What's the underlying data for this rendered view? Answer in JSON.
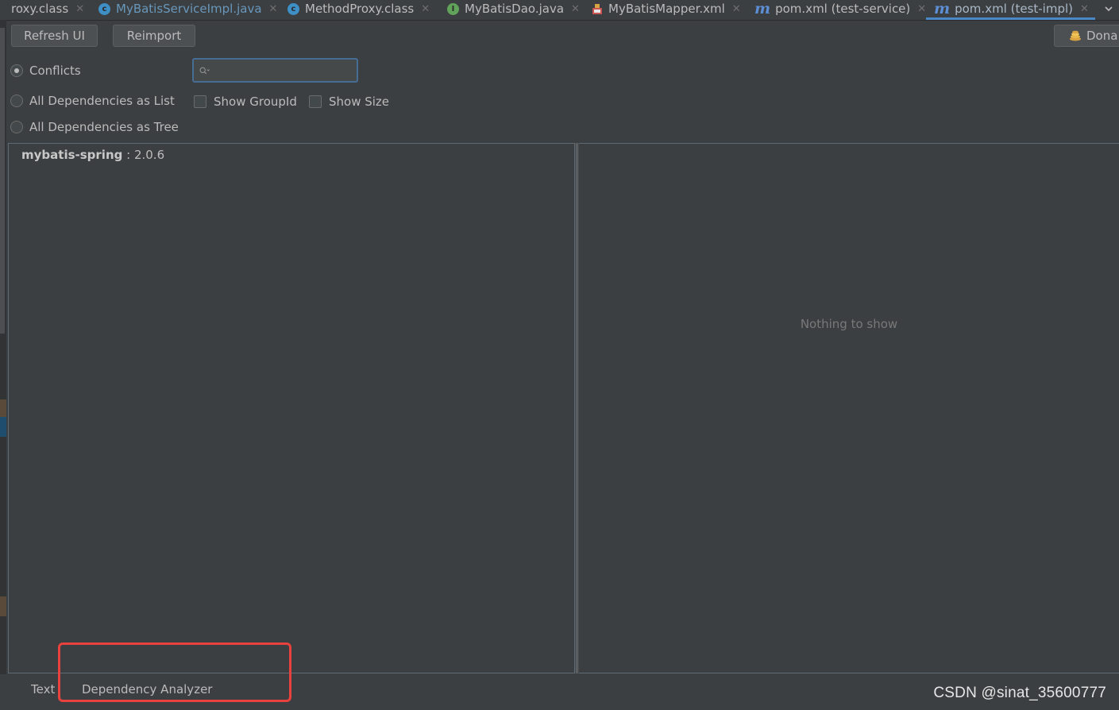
{
  "tabs": [
    {
      "label": "roxy.class",
      "icon": "none",
      "active": false
    },
    {
      "label": "MyBatisServiceImpl.java",
      "icon": "class-icon",
      "active": false
    },
    {
      "label": "MethodProxy.class",
      "icon": "class-icon",
      "active": false
    },
    {
      "label": "MyBatisDao.java",
      "icon": "interface-icon",
      "active": false
    },
    {
      "label": "MyBatisMapper.xml",
      "icon": "xml-icon",
      "active": false
    },
    {
      "label": "pom.xml (test-service)",
      "icon": "maven-icon",
      "active": false
    },
    {
      "label": "pom.xml (test-impl)",
      "icon": "maven-icon",
      "active": true
    }
  ],
  "toolbar": {
    "refresh_label": "Refresh UI",
    "reimport_label": "Reimport",
    "donate_label": "Dona"
  },
  "options": {
    "conflicts_label": "Conflicts",
    "list_label": "All Dependencies as List",
    "tree_label": "All Dependencies as Tree",
    "selected": "Conflicts",
    "show_groupid_label": "Show GroupId",
    "show_size_label": "Show Size"
  },
  "search": {
    "value": "",
    "placeholder": ""
  },
  "left_panel": {
    "items": [
      {
        "artifact": "mybatis-spring",
        "version": " : 2.0.6"
      }
    ]
  },
  "right_panel": {
    "empty_text": "Nothing to show"
  },
  "bottom_tabs": {
    "text_label": "Text",
    "analyzer_label": "Dependency Analyzer",
    "active": "Dependency Analyzer"
  },
  "watermark": "CSDN @sinat_35600777",
  "colors": {
    "background": "#3c3f41",
    "accent": "#4a88c7",
    "highlight": "#e8413e",
    "text": "#bbbbbb"
  }
}
